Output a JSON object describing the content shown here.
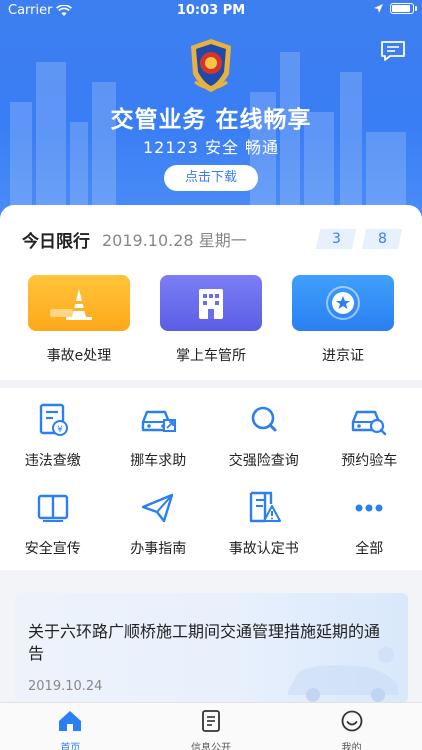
{
  "status_bar": {
    "carrier": "Carrier",
    "time": "10:03 PM"
  },
  "hero": {
    "title": "交管业务 在线畅享",
    "subtitle": "12123 安全 畅通",
    "download_label": "点击下载"
  },
  "limit": {
    "label": "今日限行",
    "date": "2019.10.28 星期一",
    "plates": [
      "3",
      "8"
    ]
  },
  "big_tiles": [
    {
      "label": "事故e处理",
      "icon": "traffic-cone-icon"
    },
    {
      "label": "掌上车管所",
      "icon": "building-icon"
    },
    {
      "label": "进京证",
      "icon": "badge-star-icon"
    }
  ],
  "services": [
    {
      "label": "违法查缴",
      "icon": "fine-document-icon"
    },
    {
      "label": "挪车求助",
      "icon": "car-move-icon"
    },
    {
      "label": "交强险查询",
      "icon": "search-icon"
    },
    {
      "label": "预约验车",
      "icon": "car-search-icon"
    },
    {
      "label": "安全宣传",
      "icon": "book-icon"
    },
    {
      "label": "办事指南",
      "icon": "paper-plane-icon"
    },
    {
      "label": "事故认定书",
      "icon": "warning-document-icon"
    },
    {
      "label": "全部",
      "icon": "more-dots-icon"
    }
  ],
  "news": {
    "title": "关于六环路广顺桥施工期间交通管理措施延期的通告",
    "date": "2019.10.24"
  },
  "tabs": [
    {
      "label": "首页",
      "icon": "home-icon",
      "active": true
    },
    {
      "label": "信息公开",
      "icon": "document-icon",
      "active": false
    },
    {
      "label": "我的",
      "icon": "smile-icon",
      "active": false
    }
  ],
  "colors": {
    "primary": "#3a7ef5",
    "orange": "#ffa81a",
    "purple": "#5b5ee3"
  }
}
